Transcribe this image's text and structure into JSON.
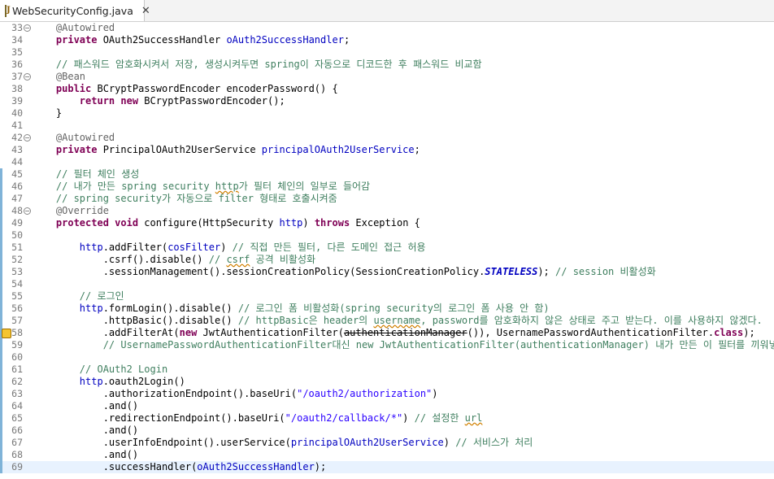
{
  "tab": {
    "filename": "WebSecurityConfig.java",
    "close": "✕",
    "icon": "java-file-icon"
  },
  "lines": [
    {
      "n": "33",
      "fold": true,
      "segs": [
        [
          "    ",
          ""
        ],
        [
          "@Autowired",
          "an"
        ]
      ]
    },
    {
      "n": "34",
      "segs": [
        [
          "    ",
          ""
        ],
        [
          "private",
          "kw"
        ],
        [
          " OAuth2SuccessHandler ",
          ""
        ],
        [
          "oAuth2SuccessHandler",
          "fld"
        ],
        [
          ";",
          ""
        ]
      ]
    },
    {
      "n": "35",
      "segs": []
    },
    {
      "n": "36",
      "segs": [
        [
          "    ",
          ""
        ],
        [
          "// 패스워드 암호화시켜서 저장, 생성시켜두면 spring이 자동으로 디코드한 후 패스워드 비교함",
          "cm"
        ]
      ]
    },
    {
      "n": "37",
      "fold": true,
      "segs": [
        [
          "    ",
          ""
        ],
        [
          "@Bean",
          "an"
        ]
      ]
    },
    {
      "n": "38",
      "segs": [
        [
          "    ",
          ""
        ],
        [
          "public",
          "kw"
        ],
        [
          " BCryptPasswordEncoder encoderPassword() {",
          ""
        ]
      ]
    },
    {
      "n": "39",
      "segs": [
        [
          "        ",
          ""
        ],
        [
          "return",
          "kw"
        ],
        [
          " ",
          ""
        ],
        [
          "new",
          "kw"
        ],
        [
          " BCryptPasswordEncoder();",
          ""
        ]
      ]
    },
    {
      "n": "40",
      "segs": [
        [
          "    }",
          ""
        ]
      ]
    },
    {
      "n": "41",
      "segs": []
    },
    {
      "n": "42",
      "fold": true,
      "segs": [
        [
          "    ",
          ""
        ],
        [
          "@Autowired",
          "an"
        ]
      ]
    },
    {
      "n": "43",
      "segs": [
        [
          "    ",
          ""
        ],
        [
          "private",
          "kw"
        ],
        [
          " PrincipalOAuth2UserService ",
          ""
        ],
        [
          "principalOAuth2UserService",
          "fld"
        ],
        [
          ";",
          ""
        ]
      ]
    },
    {
      "n": "44",
      "segs": []
    },
    {
      "n": "45",
      "marker": true,
      "segs": [
        [
          "    ",
          ""
        ],
        [
          "// 필터 체인 생성",
          "cm"
        ]
      ]
    },
    {
      "n": "46",
      "marker": true,
      "segs": [
        [
          "    ",
          ""
        ],
        [
          "// 내가 만든 spring security ",
          "cm"
        ],
        [
          "http",
          "cm squig"
        ],
        [
          "가 필터 체인의 일부로 들어감",
          "cm"
        ]
      ]
    },
    {
      "n": "47",
      "marker": true,
      "segs": [
        [
          "    ",
          ""
        ],
        [
          "// spring security가 자동으로 filter 형태로 호출시켜줌",
          "cm"
        ]
      ]
    },
    {
      "n": "48",
      "marker": true,
      "fold": true,
      "segs": [
        [
          "    ",
          ""
        ],
        [
          "@Override",
          "an"
        ]
      ]
    },
    {
      "n": "49",
      "marker": true,
      "segs": [
        [
          "    ",
          ""
        ],
        [
          "protected",
          "kw"
        ],
        [
          " ",
          ""
        ],
        [
          "void",
          "kw"
        ],
        [
          " configure(HttpSecurity ",
          ""
        ],
        [
          "http",
          "fld"
        ],
        [
          ") ",
          ""
        ],
        [
          "throws",
          "kw"
        ],
        [
          " Exception {",
          ""
        ]
      ]
    },
    {
      "n": "50",
      "marker": true,
      "segs": []
    },
    {
      "n": "51",
      "marker": true,
      "segs": [
        [
          "        ",
          ""
        ],
        [
          "http",
          "fld"
        ],
        [
          ".addFilter(",
          ""
        ],
        [
          "cosFilter",
          "fld"
        ],
        [
          ") ",
          ""
        ],
        [
          "// 직접 만든 필터, 다른 도메인 접근 허용",
          "cm"
        ]
      ]
    },
    {
      "n": "52",
      "marker": true,
      "segs": [
        [
          "            .csrf().disable() ",
          ""
        ],
        [
          "// ",
          "cm"
        ],
        [
          "csrf",
          "cm squig"
        ],
        [
          " 공격 비활성화",
          "cm"
        ]
      ]
    },
    {
      "n": "53",
      "marker": true,
      "segs": [
        [
          "            .sessionManagement().sessionCreationPolicy(SessionCreationPolicy.",
          ""
        ],
        [
          "STATELESS",
          "st"
        ],
        [
          "); ",
          ""
        ],
        [
          "// session 비활성화",
          "cm"
        ]
      ]
    },
    {
      "n": "54",
      "marker": true,
      "segs": []
    },
    {
      "n": "55",
      "marker": true,
      "segs": [
        [
          "        ",
          ""
        ],
        [
          "// 로그인",
          "cm"
        ]
      ]
    },
    {
      "n": "56",
      "marker": true,
      "segs": [
        [
          "        ",
          ""
        ],
        [
          "http",
          "fld"
        ],
        [
          ".formLogin().disable() ",
          ""
        ],
        [
          "// 로그인 폼 비활성화(spring security의 로그인 폼 사용 안 함)",
          "cm"
        ]
      ]
    },
    {
      "n": "57",
      "marker": true,
      "segs": [
        [
          "            .httpBasic().disable() ",
          ""
        ],
        [
          "// httpBasic은 header의 ",
          "cm"
        ],
        [
          "username",
          "cm squig"
        ],
        [
          ", password를 암호화하지 않은 상태로 주고 받는다. 이를 사용하지 않겠다.",
          "cm"
        ]
      ]
    },
    {
      "n": "58",
      "marker": true,
      "warn": true,
      "segs": [
        [
          "            .addFilterAt(",
          ""
        ],
        [
          "new",
          "kw"
        ],
        [
          " JwtAuthenticationFilter(",
          ""
        ],
        [
          "authenticationManager",
          "strike"
        ],
        [
          "()), UsernamePasswordAuthenticationFilter.",
          ""
        ],
        [
          "class",
          "kw"
        ],
        [
          ");",
          ""
        ]
      ]
    },
    {
      "n": "59",
      "marker": true,
      "segs": [
        [
          "            ",
          ""
        ],
        [
          "// UsernamePasswordAuthenticationFilter대신 new JwtAuthenticationFilter(authenticationManager) 내가 만든 이 필터를 끼워넣겠다.",
          "cm"
        ]
      ]
    },
    {
      "n": "60",
      "marker": true,
      "segs": []
    },
    {
      "n": "61",
      "marker": true,
      "segs": [
        [
          "        ",
          ""
        ],
        [
          "// OAuth2 Login",
          "cm"
        ]
      ]
    },
    {
      "n": "62",
      "marker": true,
      "segs": [
        [
          "        ",
          ""
        ],
        [
          "http",
          "fld"
        ],
        [
          ".oauth2Login()",
          ""
        ]
      ]
    },
    {
      "n": "63",
      "marker": true,
      "segs": [
        [
          "            .authorizationEndpoint().baseUri(",
          ""
        ],
        [
          "\"/oauth2/authorization\"",
          "str"
        ],
        [
          ")",
          ""
        ]
      ]
    },
    {
      "n": "64",
      "marker": true,
      "segs": [
        [
          "            .and()",
          ""
        ]
      ]
    },
    {
      "n": "65",
      "marker": true,
      "segs": [
        [
          "            .redirectionEndpoint().baseUri(",
          ""
        ],
        [
          "\"/oauth2/callback/*\"",
          "str"
        ],
        [
          ") ",
          ""
        ],
        [
          "// 설정한 ",
          "cm"
        ],
        [
          "url",
          "cm squig"
        ]
      ]
    },
    {
      "n": "66",
      "marker": true,
      "segs": [
        [
          "            .and()",
          ""
        ]
      ]
    },
    {
      "n": "67",
      "marker": true,
      "segs": [
        [
          "            .userInfoEndpoint().userService(",
          ""
        ],
        [
          "principalOAuth2UserService",
          "fld"
        ],
        [
          ") ",
          ""
        ],
        [
          "// 서비스가 처리",
          "cm"
        ]
      ]
    },
    {
      "n": "68",
      "marker": true,
      "segs": [
        [
          "            .and()",
          ""
        ]
      ]
    },
    {
      "n": "69",
      "marker": true,
      "current": true,
      "segs": [
        [
          "            .successHandler(",
          ""
        ],
        [
          "oAuth2SuccessHandler",
          "fld"
        ],
        [
          ");",
          ""
        ]
      ]
    }
  ]
}
